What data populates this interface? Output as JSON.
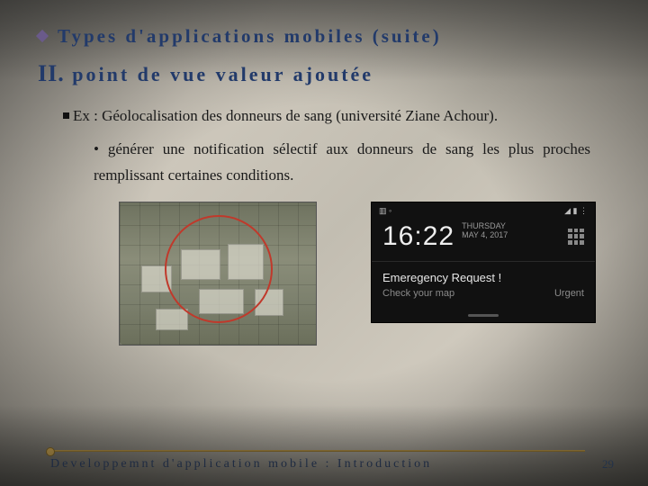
{
  "heading": {
    "title": "Types d'applications  mobiles (suite)",
    "roman": "II.",
    "subtitle": "point de vue valeur ajoutée"
  },
  "content": {
    "ex_label": "Ex",
    "ex_text": " : Géolocalisation des donneurs de sang (université Ziane Achour).",
    "bullet": "• générer une notification sélectif aux donneurs de sang les plus proches remplissant certaines conditions."
  },
  "phone": {
    "time": "16:22",
    "day": "THURSDAY",
    "date": "MAY 4, 2017",
    "notif_title": "Emeregency Request !",
    "notif_sub": "Check your map",
    "notif_tag": "Urgent"
  },
  "footer": {
    "text": "Developpemnt d'application mobile : Introduction",
    "page": "29"
  }
}
